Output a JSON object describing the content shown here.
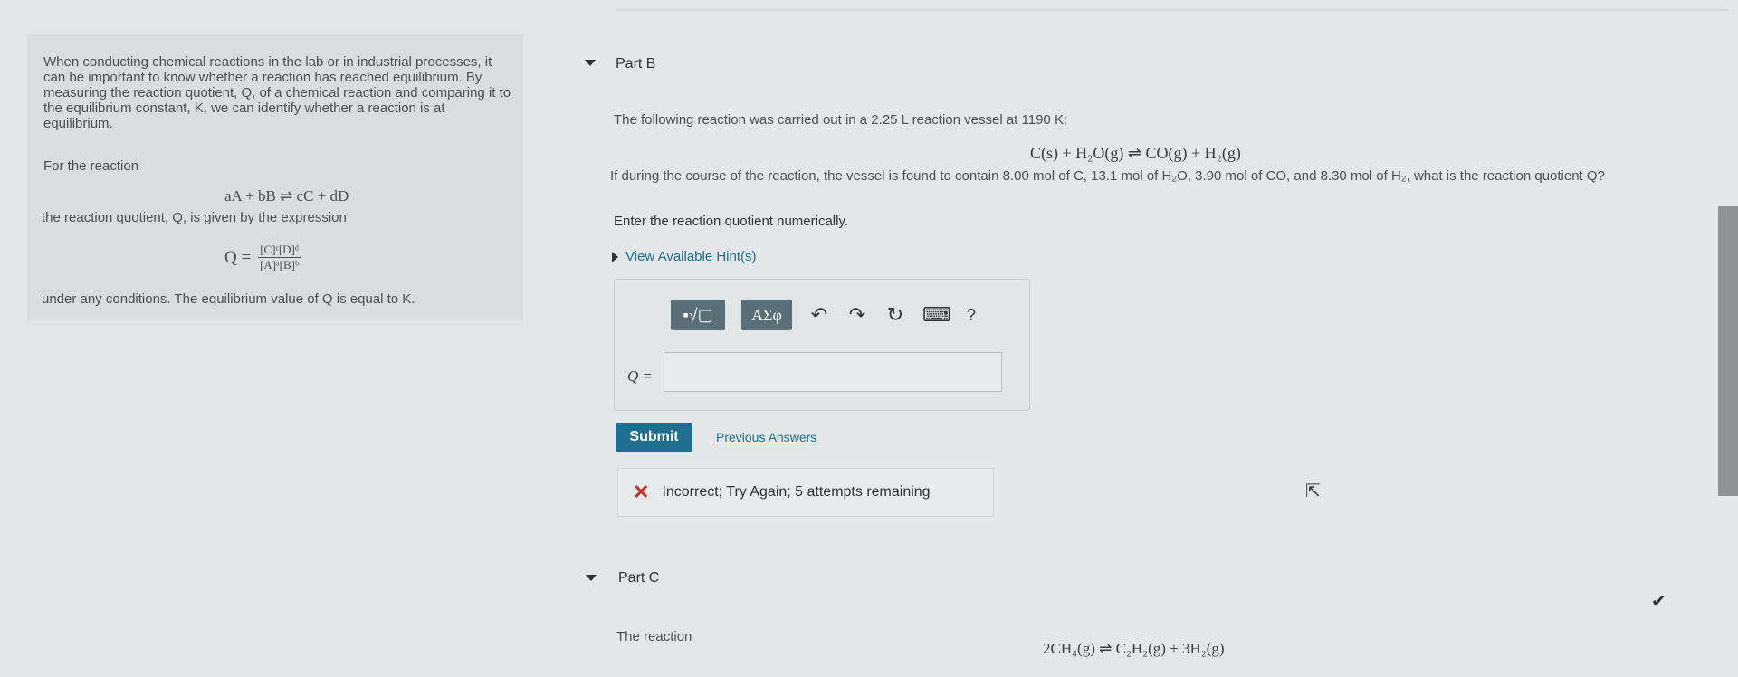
{
  "intro": {
    "para1": "When conducting chemical reactions in the lab or in industrial processes, it can be important to know whether a reaction has reached equilibrium. By measuring the reaction quotient, Q, of a chemical reaction and comparing it to the equilibrium constant, K, we can identify whether a reaction is at equilibrium.",
    "for_reaction": "For the reaction",
    "general_reaction": "aA + bB ⇌ cC + dD",
    "given_text": "the reaction quotient, Q, is given by the expression",
    "q_lhs": "Q =",
    "q_numerator": "[C]ᶜ[D]ᵈ",
    "q_denominator": "[A]ᵃ[B]ᵇ",
    "equil_text": "under any conditions. The equilibrium value of Q is equal to K."
  },
  "part_b": {
    "title": "Part B",
    "intro": "The following reaction was carried out in a 2.25 L reaction vessel at 1190 K:",
    "reaction": "C(s) + H₂O(g) ⇌ CO(g) + H₂(g)",
    "question": "If during the course of the reaction, the vessel is found to contain 8.00 mol of C, 13.1 mol of H₂O, 3.90 mol of CO, and 8.30 mol of H₂, what is the reaction quotient Q?",
    "instruction": "Enter the reaction quotient numerically.",
    "hint": "View Available Hint(s)",
    "toolbar": {
      "math_btn": "▪√▢",
      "greek_btn": "ΑΣφ",
      "undo_icon": "↶",
      "redo_icon": "↷",
      "reset_icon": "↻",
      "keyboard_icon": "⌨",
      "help_icon": "?"
    },
    "answer_label": "Q =",
    "answer_value": "",
    "submit_label": "Submit",
    "previous_answers": "Previous Answers",
    "feedback": "Incorrect; Try Again; 5 attempts remaining"
  },
  "part_c": {
    "title": "Part C",
    "intro": "The reaction",
    "reaction": "2CH₄(g) ⇌ C₂H₂(g) + 3H₂(g)"
  },
  "colors": {
    "accent": "#1f6e8f",
    "error": "#c9302c",
    "toolbar": "#5b6f79"
  }
}
